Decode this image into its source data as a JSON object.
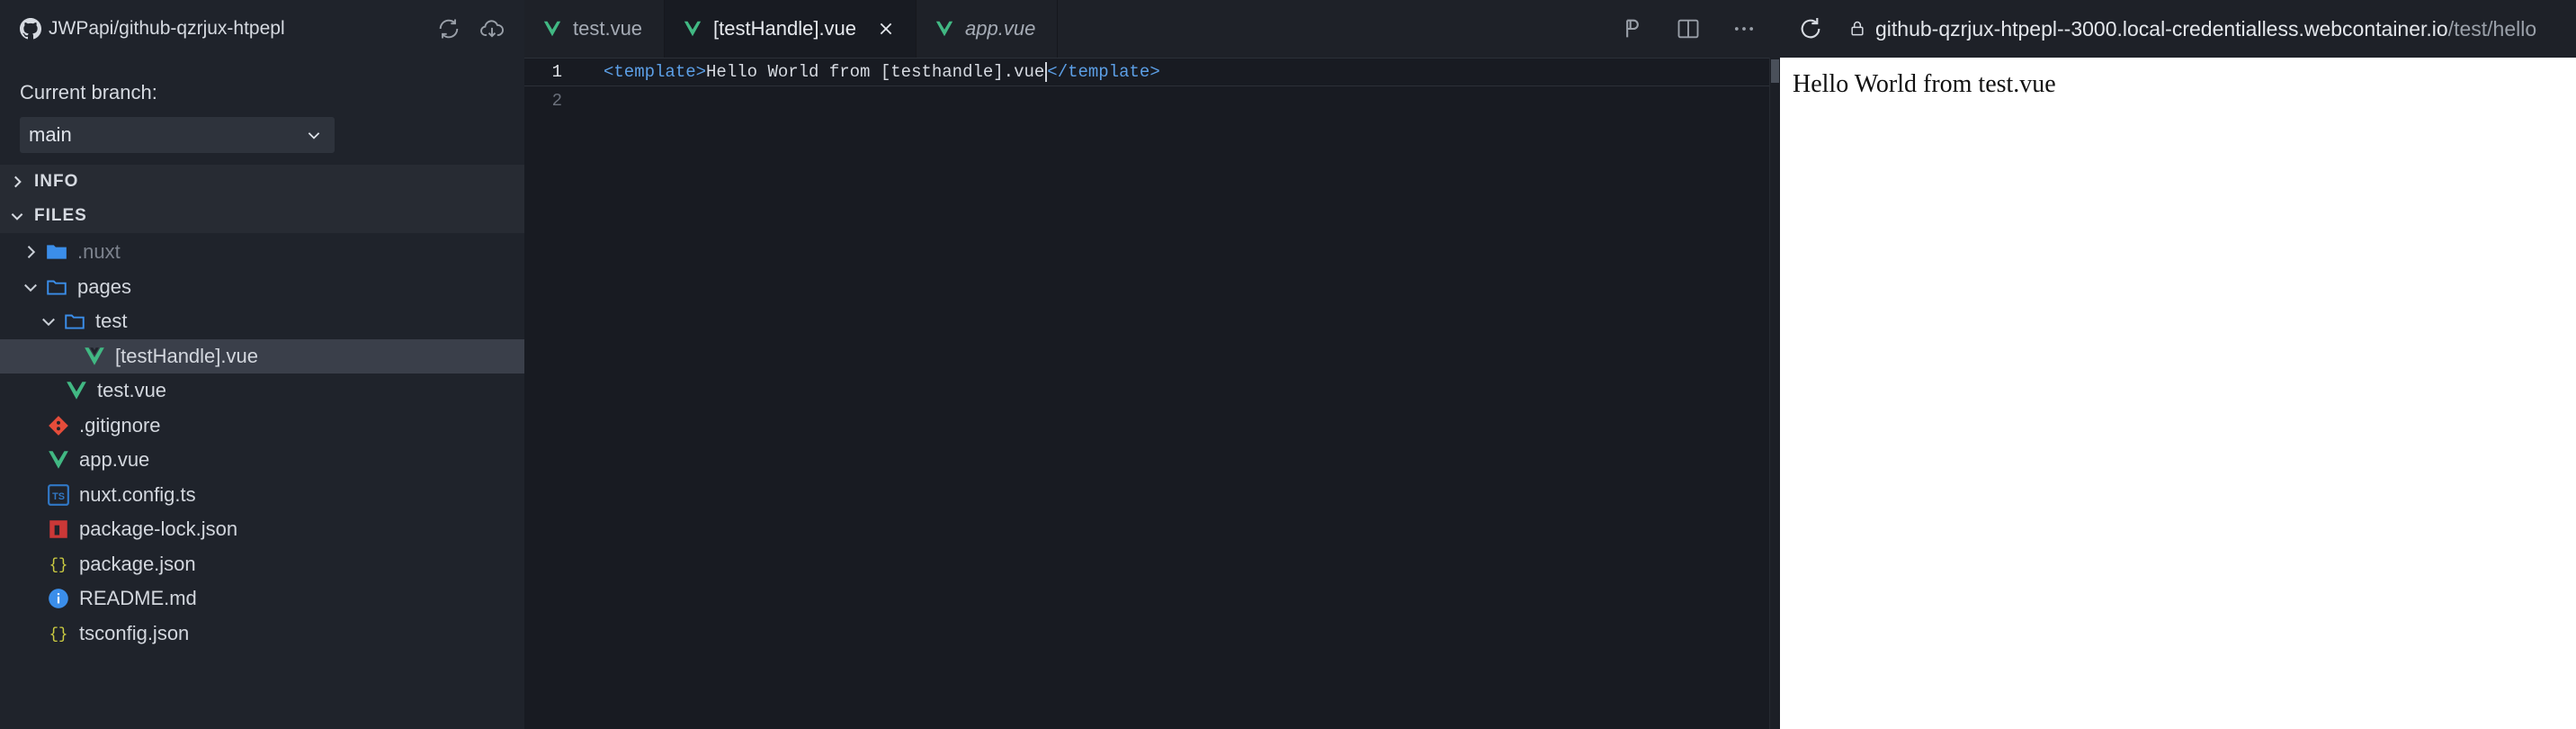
{
  "repo": {
    "title": "JWPapi/github-qzrjux-htpepl"
  },
  "branch": {
    "label": "Current branch:",
    "value": "main"
  },
  "sections": {
    "info": "INFO",
    "files": "FILES"
  },
  "tree": [
    {
      "name": ".nuxt",
      "type": "folder",
      "depth": 0,
      "expanded": false,
      "dim": true
    },
    {
      "name": "pages",
      "type": "folder",
      "depth": 0,
      "expanded": true
    },
    {
      "name": "test",
      "type": "folder",
      "depth": 1,
      "expanded": true
    },
    {
      "name": "[testHandle].vue",
      "type": "vue",
      "depth": 2,
      "selected": true
    },
    {
      "name": "test.vue",
      "type": "vue",
      "depth": 1
    },
    {
      "name": ".gitignore",
      "type": "git",
      "depth": 0
    },
    {
      "name": "app.vue",
      "type": "vue",
      "depth": 0
    },
    {
      "name": "nuxt.config.ts",
      "type": "ts",
      "depth": 0
    },
    {
      "name": "package-lock.json",
      "type": "npm",
      "depth": 0
    },
    {
      "name": "package.json",
      "type": "json",
      "depth": 0
    },
    {
      "name": "README.md",
      "type": "info",
      "depth": 0
    },
    {
      "name": "tsconfig.json",
      "type": "json",
      "depth": 0
    }
  ],
  "tabs": [
    {
      "label": "test.vue",
      "active": false,
      "italic": false
    },
    {
      "label": "[testHandle].vue",
      "active": true,
      "italic": false
    },
    {
      "label": "app.vue",
      "active": false,
      "italic": true
    }
  ],
  "editor": {
    "lines": [
      {
        "number": "1",
        "open_tag": "<template>",
        "text": "Hello World from [testhandle].vue",
        "close_tag": "</template>"
      },
      {
        "number": "2"
      }
    ]
  },
  "preview": {
    "url_host": "github-qzrjux-htpepl--3000.local-credentialless.webcontainer.io",
    "url_path": "/test/hello",
    "content": "Hello World from test.vue"
  },
  "colors": {
    "vue": "#41b883",
    "folder": "#3b8eea",
    "git": "#e44c3a",
    "ts": "#3178c6",
    "npm": "#cb3837",
    "json": "#cbcb41",
    "info": "#3b8eea"
  }
}
